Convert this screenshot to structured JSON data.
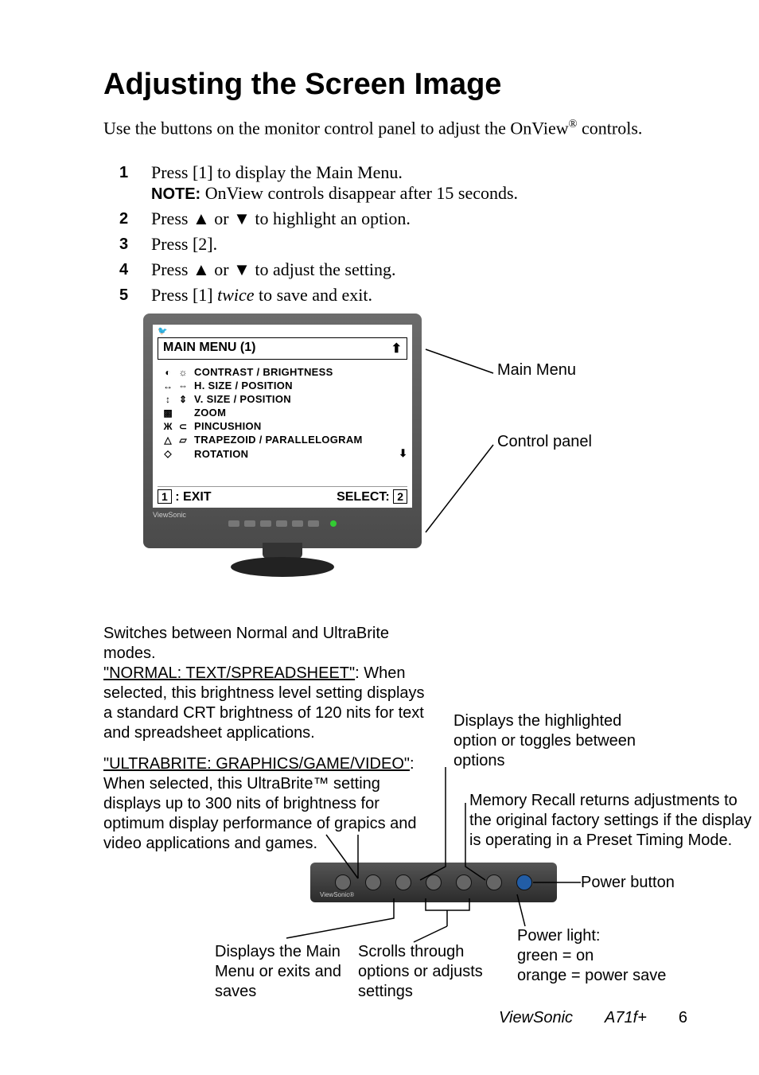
{
  "title": "Adjusting the Screen Image",
  "intro_before": "Use the buttons on the monitor control panel to adjust the OnView",
  "intro_after": " controls.",
  "reg_mark": "®",
  "steps": {
    "s1": "Press [1] to display the Main Menu.",
    "note_label": "NOTE:",
    "note_text": " OnView controls disappear after 15 seconds.",
    "s2a": "Press ",
    "s2b": " or ",
    "s2c": " to highlight an option.",
    "s3": "Press [2].",
    "s4a": "Press ",
    "s4b": " or ",
    "s4c": " to adjust the setting.",
    "s5a": "Press [1] ",
    "s5_italic": "twice",
    "s5b": " to save and exit."
  },
  "arrows": {
    "up": "▲",
    "down": "▼"
  },
  "osd": {
    "title": "MAIN MENU (1)",
    "title_arrow": "⬆",
    "items": [
      {
        "ic1": "◐",
        "ic2": "☼",
        "label": "CONTRAST / BRIGHTNESS"
      },
      {
        "ic1": "↔",
        "ic2": "⇔",
        "label": "H. SIZE / POSITION"
      },
      {
        "ic1": "↕",
        "ic2": "⇕",
        "label": "V. SIZE / POSITION"
      },
      {
        "ic1": "▩",
        "ic2": "",
        "label": "ZOOM"
      },
      {
        "ic1": "Ж",
        "ic2": "⊂",
        "label": "PINCUSHION"
      },
      {
        "ic1": "△",
        "ic2": "▱",
        "label": "TRAPEZOID / PARALLELOGRAM"
      },
      {
        "ic1": "◇",
        "ic2": "",
        "label": "ROTATION"
      }
    ],
    "list_arrow": "⬇",
    "exit_key": "1",
    "exit_text": " : EXIT",
    "select_text": "SELECT: ",
    "select_key": "2"
  },
  "callouts": {
    "main_menu": "Main Menu",
    "control_panel": "Control panel"
  },
  "modes": {
    "intro": "Switches between Normal and UltraBrite modes.",
    "normal_label": "\"NORMAL: TEXT/SPREADSHEET\"",
    "normal_text": ": When selected, this brightness level setting displays a standard CRT brightness of 120 nits for text and spreadsheet applications.",
    "ultra_label": "\"ULTRABRITE: GRAPHICS/GAME/VIDEO\"",
    "ultra_text": ": When selected, this UltraBrite™ setting displays up to 300 nits of brightness for optimum display performance of grapics and video applications and games."
  },
  "panel_callouts": {
    "displays_option": "Displays the highlighted option or toggles between options",
    "memory_recall": "Memory Recall returns adjustments to the original factory settings if the display is operating in a Preset Timing Mode.",
    "power_button": "Power button",
    "power_light": "Power light:",
    "pl_green": "green = on",
    "pl_orange": "orange = power save",
    "displays_main": "Displays the Main Menu or exits and saves",
    "scrolls": "Scrolls through options or adjusts settings"
  },
  "footer": {
    "brand": "ViewSonic",
    "model": "A71f+",
    "page": "6"
  }
}
